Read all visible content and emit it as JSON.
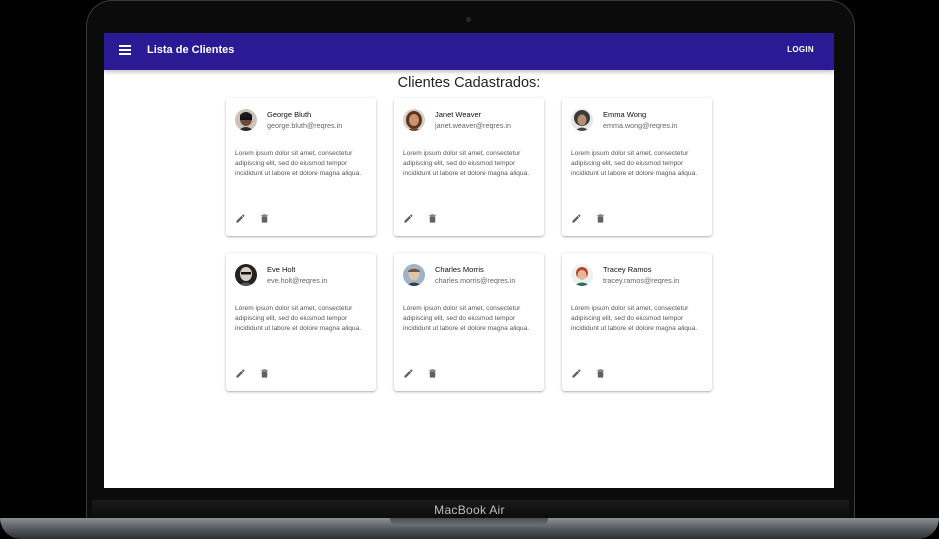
{
  "device": {
    "label": "MacBook Air"
  },
  "appbar": {
    "title": "Lista de Clientes",
    "login_label": "LOGIN",
    "color": "#2c1a94"
  },
  "main": {
    "heading": "Clientes Cadastrados:"
  },
  "cards": [
    {
      "name": "George Bluth",
      "email": "george.bluth@reqres.in",
      "description": "Lorem ipsum dolor sit amet, consectetur adipiscing elit, sed do eiusmod tempor incididunt ut labore et dolore magna aliqua."
    },
    {
      "name": "Janet Weaver",
      "email": "janet.weaver@reqres.in",
      "description": "Lorem ipsum dolor sit amet, consectetur adipiscing elit, sed do eiusmod tempor incididunt ut labore et dolore magna aliqua."
    },
    {
      "name": "Emma Wong",
      "email": "emma.wong@reqres.in",
      "description": "Lorem ipsum dolor sit amet, consectetur adipiscing elit, sed do eiusmod tempor incididunt ut labore et dolore magna aliqua."
    },
    {
      "name": "Eve Holt",
      "email": "eve.holt@reqres.in",
      "description": "Lorem ipsum dolor sit amet, consectetur adipiscing elit, sed do eiusmod tempor incididunt ut labore et dolore magna aliqua."
    },
    {
      "name": "Charles Morris",
      "email": "charles.morris@reqres.in",
      "description": "Lorem ipsum dolor sit amet, consectetur adipiscing elit, sed do eiusmod tempor incididunt ut labore et dolore magna aliqua."
    },
    {
      "name": "Tracey Ramos",
      "email": "tracey.ramos@reqres.in",
      "description": "Lorem ipsum dolor sit amet, consectetur adipiscing elit, sed do eiusmod tempor incididunt ut labore et dolore magna aliqua."
    }
  ],
  "icons": {
    "menu": "menu-icon",
    "edit": "pencil-icon",
    "delete": "trash-icon",
    "avatar": "avatar-photo"
  }
}
